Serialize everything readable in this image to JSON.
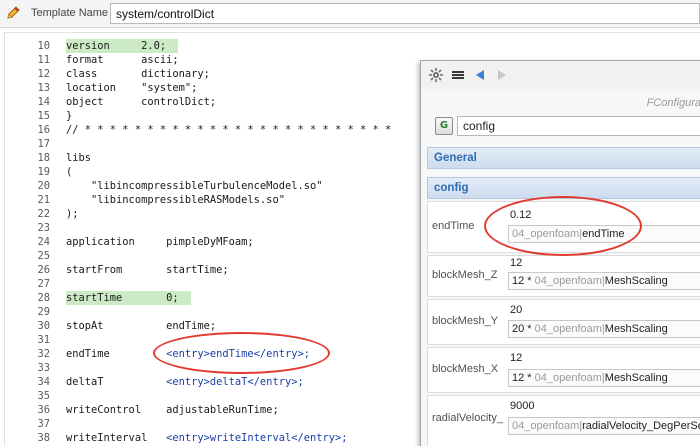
{
  "template_bar": {
    "label": "Template Name",
    "value": "system/controlDict"
  },
  "editor": {
    "lines": [
      {
        "n": "10",
        "text": "version     2.0;",
        "hl": true
      },
      {
        "n": "11",
        "text": "format      ascii;"
      },
      {
        "n": "12",
        "text": "class       dictionary;"
      },
      {
        "n": "13",
        "text": "location    \"system\";"
      },
      {
        "n": "14",
        "text": "object      controlDict;"
      },
      {
        "n": "15",
        "text": "}"
      },
      {
        "n": "16",
        "text": "// * * * * * * * * * * * * * * * * * * * * * * * * *"
      },
      {
        "n": "17",
        "text": ""
      },
      {
        "n": "18",
        "text": "libs"
      },
      {
        "n": "19",
        "text": "("
      },
      {
        "n": "20",
        "text": "    \"libincompressibleTurbulenceModel.so\""
      },
      {
        "n": "21",
        "text": "    \"libincompressibleRASModels.so\""
      },
      {
        "n": "22",
        "text": ");"
      },
      {
        "n": "23",
        "text": ""
      },
      {
        "n": "24",
        "text": "application     pimpleDyMFoam;"
      },
      {
        "n": "25",
        "text": ""
      },
      {
        "n": "26",
        "text": "startFrom       startTime;"
      },
      {
        "n": "27",
        "text": ""
      },
      {
        "n": "28",
        "text": "startTime       0;",
        "hl": true
      },
      {
        "n": "29",
        "text": ""
      },
      {
        "n": "30",
        "text": "stopAt          endTime;"
      },
      {
        "n": "31",
        "text": ""
      },
      {
        "n": "32",
        "text": "endTime         ",
        "tag": "<entry>endTime</entry>;"
      },
      {
        "n": "33",
        "text": ""
      },
      {
        "n": "34",
        "text": "deltaT          ",
        "tag": "<entry>deltaT</entry>;"
      },
      {
        "n": "35",
        "text": ""
      },
      {
        "n": "36",
        "text": "writeControl    adjustableRunTime;"
      },
      {
        "n": "37",
        "text": ""
      },
      {
        "n": "38",
        "text": "writeInterval   ",
        "tag": "<entry>writeInterval</entry>;"
      }
    ]
  },
  "panel": {
    "title": "FConfigura",
    "config_field": "config",
    "config_icon": "G",
    "sections": {
      "general": "General",
      "config": "config"
    },
    "props": [
      {
        "name": "endTime",
        "value": "0.12",
        "expr_prefix": "",
        "expr_gray": "04_openfoam",
        "expr_dark": "endTime"
      },
      {
        "name": "blockMesh_Z",
        "value": "12",
        "expr_prefix": "12 * ",
        "expr_gray": "04_openfoam",
        "expr_dark": "MeshScaling"
      },
      {
        "name": "blockMesh_Y",
        "value": "20",
        "expr_prefix": "20 * ",
        "expr_gray": "04_openfoam",
        "expr_dark": "MeshScaling"
      },
      {
        "name": "blockMesh_X",
        "value": "12",
        "expr_prefix": "12 * ",
        "expr_gray": "04_openfoam",
        "expr_dark": "MeshScaling"
      },
      {
        "name": "radialVelocity_",
        "value": "9000",
        "expr_prefix": "",
        "expr_gray": "04_openfoam",
        "expr_dark": "radialVelocity_DegPerSec"
      }
    ]
  },
  "icons": {
    "pencil": "pencil-icon",
    "toolbar": [
      "settings-icon",
      "list-icon",
      "back-arrow-icon",
      "forward-arrow-icon"
    ]
  },
  "colors": {
    "highlight": "#cdeac6",
    "annotation_red": "#e23b2e",
    "section_blue": "#2f6bb0",
    "xml_tag_blue": "#1b3fa8"
  }
}
